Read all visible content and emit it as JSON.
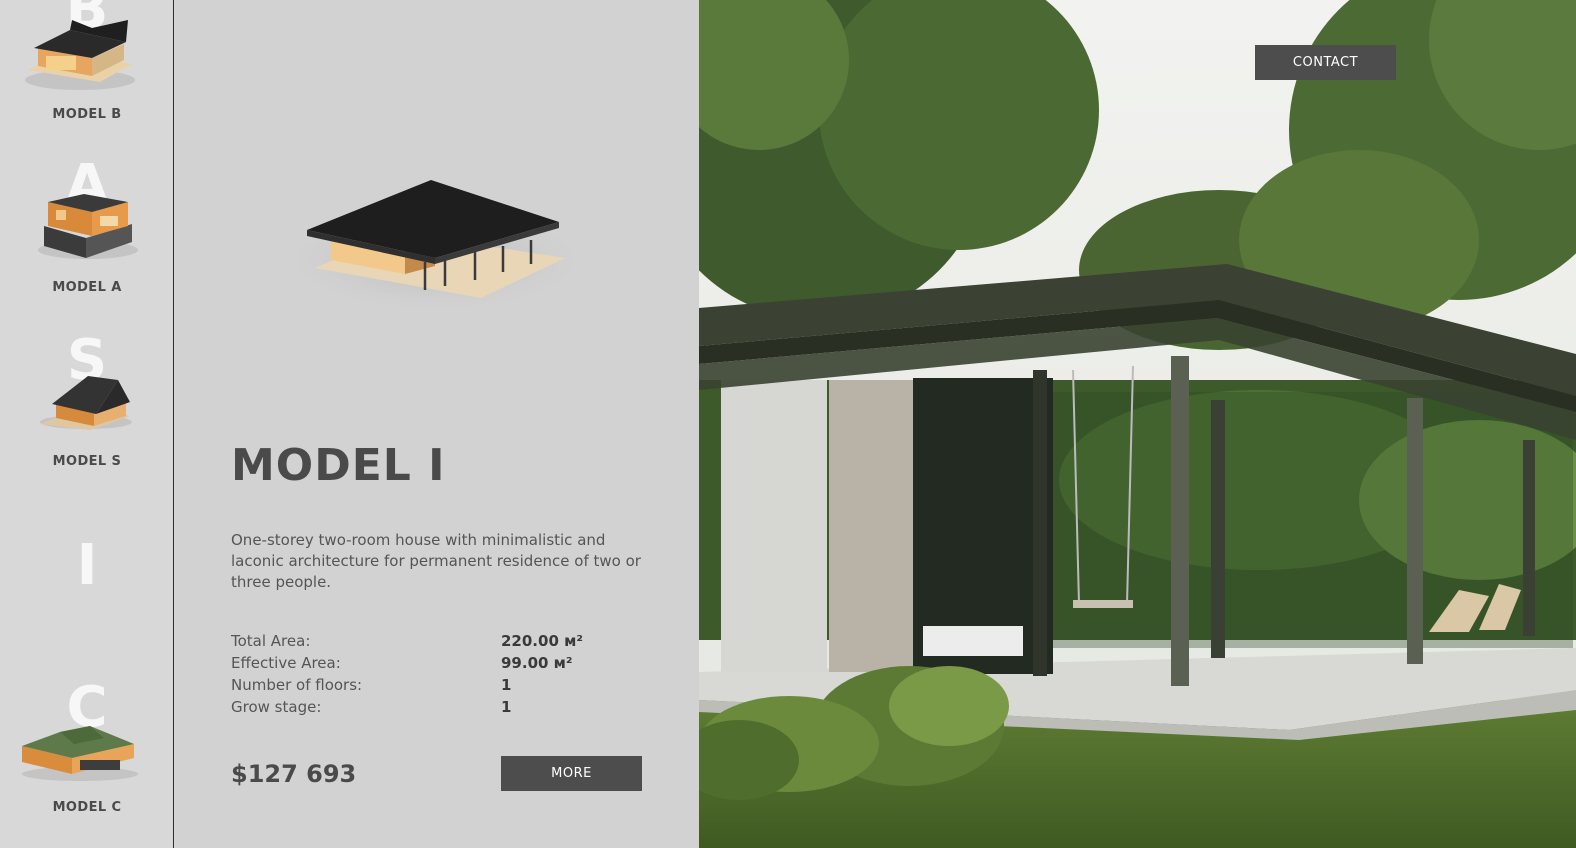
{
  "sidebar": {
    "letters": [
      "B",
      "A",
      "S",
      "I",
      "C"
    ],
    "models": [
      {
        "label": "MODEL B"
      },
      {
        "label": "MODEL A"
      },
      {
        "label": "MODEL S"
      },
      {
        "label": "MODEL C"
      }
    ]
  },
  "detail": {
    "title": "MODEL I",
    "description": "One-storey two-room house with minimalistic and laconic architecture for permanent residence of two or three people.",
    "specs": [
      {
        "label": "Total Area:",
        "value": "220.00 м²"
      },
      {
        "label": "Effective Area:",
        "value": "99.00 м²"
      },
      {
        "label": "Number of floors:",
        "value": "1"
      },
      {
        "label": "Grow stage:",
        "value": "1"
      }
    ],
    "price": "$127 693",
    "more_label": "MORE"
  },
  "header": {
    "contact_label": "CONTACT"
  },
  "colors": {
    "button_bg": "#4d4d4d",
    "panel_bg": "#d2d2d2",
    "sidebar_bg": "#d8d8d8"
  }
}
